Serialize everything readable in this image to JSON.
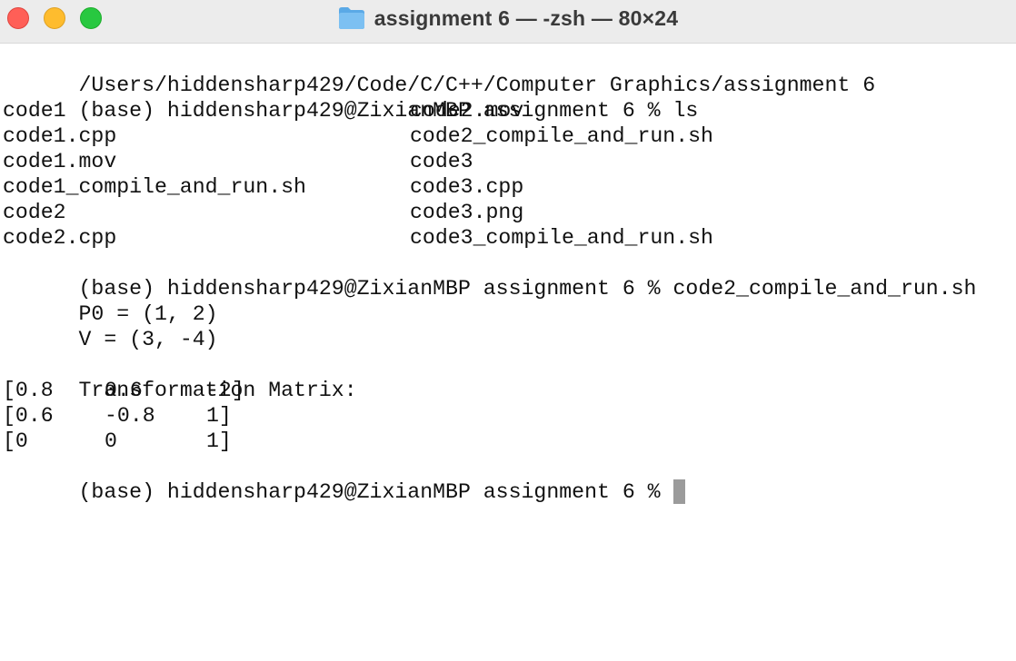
{
  "window": {
    "title": "assignment 6 — -zsh — 80×24",
    "folder_icon": "folder-icon",
    "colors": {
      "close": "#ff5f57",
      "minimize": "#febc2e",
      "maximize": "#28c840",
      "cursor": "#9b9b9b"
    }
  },
  "terminal": {
    "line_path": "/Users/hiddensharp429/Code/C/C++/Computer Graphics/assignment 6",
    "prompt": "(base) hiddensharp429@ZixianMBP assignment 6 % ",
    "cmd1": "ls",
    "ls_rows": [
      [
        "code1",
        "code2.mov"
      ],
      [
        "code1.cpp",
        "code2_compile_and_run.sh"
      ],
      [
        "code1.mov",
        "code3"
      ],
      [
        "code1_compile_and_run.sh",
        "code3.cpp"
      ],
      [
        "code2",
        "code3.png"
      ],
      [
        "code2.cpp",
        "code3_compile_and_run.sh"
      ]
    ],
    "cmd2": "code2_compile_and_run.sh",
    "out_p0": "P0 = (1, 2)",
    "out_v": "V = (3, -4)",
    "out_matrix_title": "Transformation Matrix:",
    "matrix_rows": [
      [
        "[0.8",
        "0.6",
        "-2]"
      ],
      [
        "[0.6",
        "-0.8",
        "1]"
      ],
      [
        "[0",
        "0",
        "1]"
      ]
    ],
    "final_prompt": "(base) hiddensharp429@ZixianMBP assignment 6 % "
  }
}
